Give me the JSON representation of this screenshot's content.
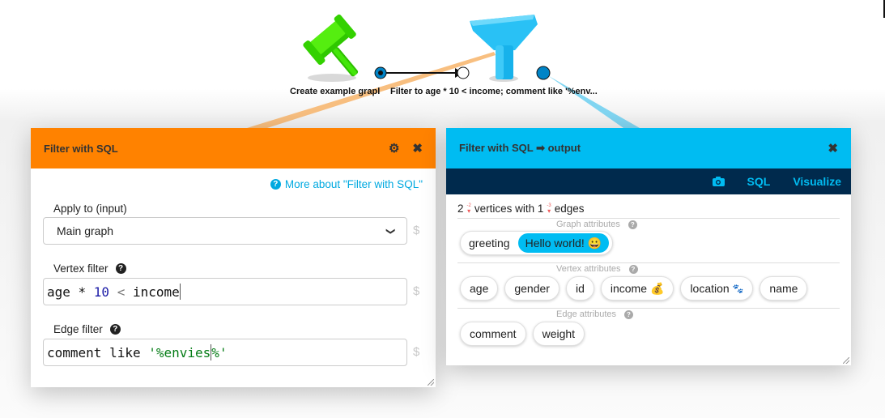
{
  "workspace": {
    "boxes": [
      {
        "name": "create-example-graph",
        "icon": "gavel-icon",
        "color": "#33dd00",
        "label": "Create example grapl"
      },
      {
        "name": "filter-with-sql",
        "icon": "funnel-icon",
        "color": "#00bcf2",
        "label": "Filter to age * 10 < income; comment like '%env..."
      }
    ],
    "colors": {
      "orange_beam": "#f7b46a",
      "blue_beam": "#6ccff0",
      "port": "#0084c7"
    }
  },
  "left_popup": {
    "title": "Filter with SQL",
    "settings_icon": "gear-icon",
    "close_icon": "close-icon",
    "header_color": "#ff8200",
    "help_link": "More about \"Filter with SQL\"",
    "params": [
      {
        "label": "Apply to (input)",
        "type": "select",
        "value": "Main graph",
        "has_help": false
      },
      {
        "label": "Vertex filter",
        "type": "code",
        "value": "age * 10 < income",
        "has_help": true,
        "tokens": [
          {
            "t": "age * ",
            "c": ""
          },
          {
            "t": "10",
            "c": "num"
          },
          {
            "t": " < ",
            "c": "op"
          },
          {
            "t": "income",
            "c": ""
          }
        ]
      },
      {
        "label": "Edge filter",
        "type": "code",
        "value": "comment like '%envies%'",
        "has_help": true,
        "tokens": [
          {
            "t": "comment like ",
            "c": ""
          },
          {
            "t": "'%envies",
            "c": "str"
          },
          {
            "t": "%'",
            "c": "str"
          }
        ]
      }
    ],
    "dollar": "$"
  },
  "right_popup": {
    "title": "Filter with SQL ➡ output",
    "close_icon": "close-icon",
    "header_color": "#00bcf2",
    "toolbar": {
      "camera_icon": "camera-icon",
      "sql": "SQL",
      "visualize": "Visualize"
    },
    "summary": {
      "vertices": "2",
      "vertices_delta": "-2",
      "vertices_label": "vertices with",
      "edges": "1",
      "edges_delta": "-3",
      "edges_label": "edges"
    },
    "graph_attributes": {
      "title": "Graph attributes",
      "items": [
        {
          "name": "greeting",
          "value": "Hello world!",
          "emoji": "😀"
        }
      ]
    },
    "vertex_attributes": {
      "title": "Vertex attributes",
      "items": [
        {
          "name": "age",
          "emoji": ""
        },
        {
          "name": "gender",
          "emoji": ""
        },
        {
          "name": "id",
          "emoji": ""
        },
        {
          "name": "income",
          "emoji": "💰"
        },
        {
          "name": "location",
          "emoji": "🐾"
        },
        {
          "name": "name",
          "emoji": ""
        }
      ]
    },
    "edge_attributes": {
      "title": "Edge attributes",
      "items": [
        {
          "name": "comment",
          "emoji": ""
        },
        {
          "name": "weight",
          "emoji": ""
        }
      ]
    }
  }
}
